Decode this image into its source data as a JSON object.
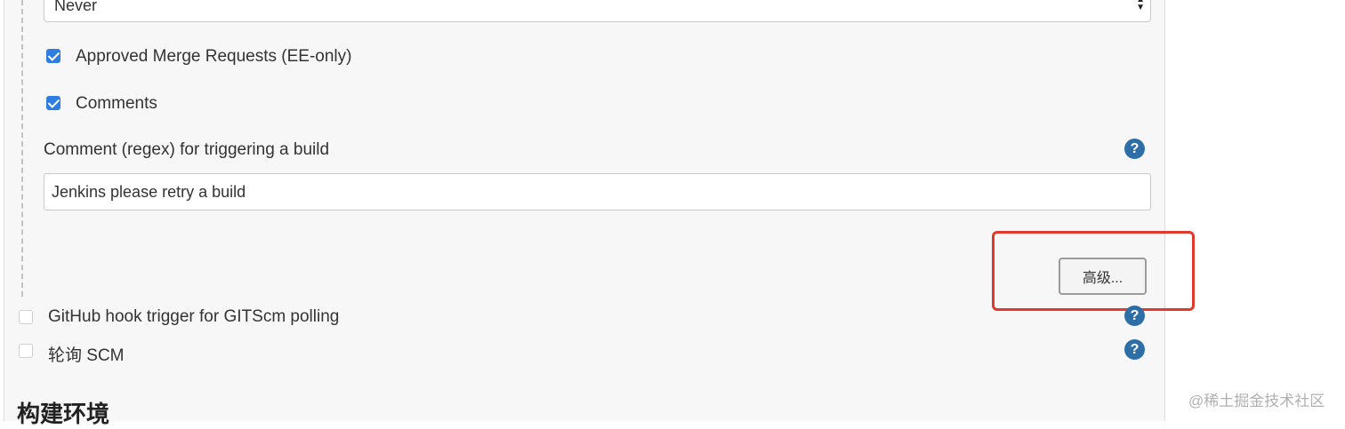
{
  "config": {
    "select_value": "Never",
    "approved_mr_label": "Approved Merge Requests (EE-only)",
    "approved_mr_checked": true,
    "comments_label": "Comments",
    "comments_checked": true,
    "comment_regex_label": "Comment (regex) for triggering a build",
    "comment_regex_value": "Jenkins please retry a build",
    "advanced_button_label": "高级...",
    "help_glyph": "?"
  },
  "triggers": [
    {
      "label": "GitHub hook trigger for GITScm polling",
      "checked": false
    },
    {
      "label": "轮询 SCM",
      "checked": false
    }
  ],
  "section": {
    "title": "构建环境"
  },
  "watermark": "@稀土掘金技术社区",
  "colors": {
    "checkbox_checked": "#2f7de1",
    "help_icon": "#2e6ea6",
    "highlight": "#e03a2f",
    "panel_bg": "#f7f7f7"
  },
  "icons": {
    "help": "question-circle-icon",
    "select_arrows": "updown-arrows-icon",
    "checkmark": "checkmark-icon"
  }
}
